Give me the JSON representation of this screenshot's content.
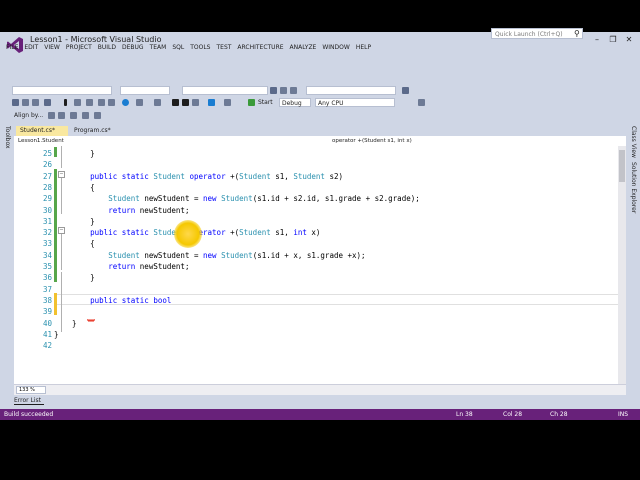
{
  "window": {
    "title": "Lesson1 - Microsoft Visual Studio",
    "quick_launch_placeholder": "Quick Launch (Ctrl+Q)",
    "controls": [
      "–",
      "❐",
      "✕"
    ]
  },
  "menu": [
    "FILE",
    "EDIT",
    "VIEW",
    "PROJECT",
    "BUILD",
    "DEBUG",
    "TEAM",
    "SQL",
    "TOOLS",
    "TEST",
    "ARCHITECTURE",
    "ANALYZE",
    "WINDOW",
    "HELP"
  ],
  "toolbar": {
    "start_label": "Start",
    "config_value": "Debug",
    "platform_value": "Any CPU",
    "align_label": "Align by..."
  },
  "tabs": [
    {
      "label": "Student.cs*",
      "active": true
    },
    {
      "label": "Program.cs*",
      "active": false
    }
  ],
  "navbar": {
    "class_path": "Lesson1.Student",
    "member_path": "operator +(Student s1, int x)"
  },
  "side_panels": {
    "left": "Toolbox",
    "right_top": "Class View",
    "right_bottom": "Solution Explorer"
  },
  "editor": {
    "lines": [
      {
        "n": "25",
        "text": "        }"
      },
      {
        "n": "26",
        "text": ""
      },
      {
        "n": "27",
        "text": "        public static Student operator +(Student s1, Student s2)"
      },
      {
        "n": "28",
        "text": "        {"
      },
      {
        "n": "29",
        "text": "            Student newStudent = new Student(s1.id + s2.id, s1.grade + s2.grade);"
      },
      {
        "n": "30",
        "text": "            return newStudent;"
      },
      {
        "n": "31",
        "text": "        }"
      },
      {
        "n": "32",
        "text": "        public static Student operator +(Student s1, int x)"
      },
      {
        "n": "33",
        "text": "        {"
      },
      {
        "n": "34",
        "text": "            Student newStudent = new Student(s1.id + x, s1.grade +x);"
      },
      {
        "n": "35",
        "text": "            return newStudent;"
      },
      {
        "n": "36",
        "text": "        }"
      },
      {
        "n": "37",
        "text": ""
      },
      {
        "n": "38",
        "text": "        public static bool"
      },
      {
        "n": "39",
        "text": ""
      },
      {
        "n": "40",
        "text": "    }"
      },
      {
        "n": "41",
        "text": "}"
      },
      {
        "n": "42",
        "text": ""
      }
    ],
    "zoom": "133 %"
  },
  "bottom": {
    "error_list": "Error List"
  },
  "status": {
    "message": "Build succeeded",
    "line": "Ln 38",
    "col": "Col 28",
    "ch": "Ch 28",
    "mode": "INS"
  },
  "colors": {
    "keyword": "#0000ff",
    "type": "#2b91af",
    "status_bar": "#68217a",
    "chrome": "#cfd6e5"
  }
}
